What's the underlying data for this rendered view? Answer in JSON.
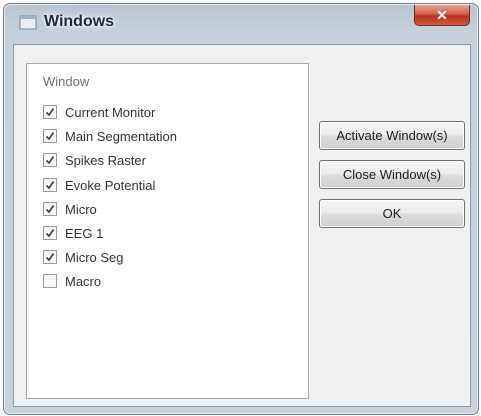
{
  "window": {
    "title": "Windows",
    "close_glyph": "✕",
    "icon": "window-app-icon"
  },
  "list": {
    "header": "Window",
    "items": [
      {
        "label": "Current Monitor",
        "checked": true
      },
      {
        "label": "Main Segmentation",
        "checked": true
      },
      {
        "label": "Spikes Raster",
        "checked": true
      },
      {
        "label": "Evoke Potential",
        "checked": true
      },
      {
        "label": "Micro",
        "checked": true
      },
      {
        "label": "EEG 1",
        "checked": true
      },
      {
        "label": "Micro Seg",
        "checked": true
      },
      {
        "label": "Macro",
        "checked": false
      }
    ]
  },
  "buttons": {
    "activate": "Activate Window(s)",
    "close": "Close Window(s)",
    "ok": "OK"
  }
}
